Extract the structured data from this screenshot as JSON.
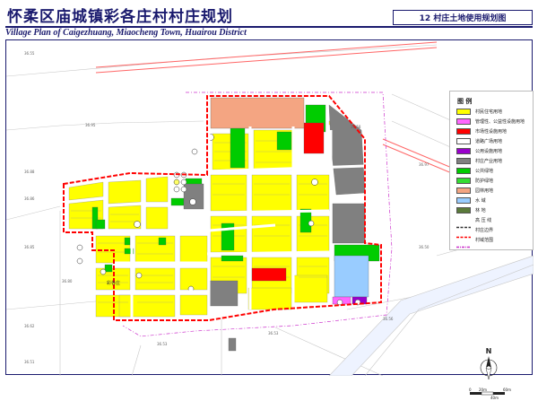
{
  "header": {
    "title_cn": "怀柔区庙城镇彩各庄村村庄规划",
    "title_en": "Village Plan of Caigezhuang, Miaocheng Town, Huairou District",
    "sheet": "12 村庄土地使用规划图"
  },
  "map": {
    "street_label": "彩各庄",
    "legend_title": "图 例",
    "legend": [
      {
        "label": "村民住宅用地",
        "color": "#ffff00",
        "kind": "fill"
      },
      {
        "label": "管理性、公益性设施用地",
        "color": "#ff66ff",
        "kind": "fill"
      },
      {
        "label": "市场性设施用地",
        "color": "#ff0000",
        "kind": "fill"
      },
      {
        "label": "道路广场用地",
        "color": "#ffffff",
        "kind": "fill"
      },
      {
        "label": "公用设施用地",
        "color": "#9900cc",
        "kind": "fill"
      },
      {
        "label": "村庄产业用地",
        "color": "#808080",
        "kind": "fill"
      },
      {
        "label": "公共绿地",
        "color": "#00cc00",
        "kind": "fill"
      },
      {
        "label": "防护绿地",
        "color": "#33dd33",
        "kind": "fill"
      },
      {
        "label": "园林用地",
        "color": "#f4a582",
        "kind": "fill"
      },
      {
        "label": "水  域",
        "color": "#99ccff",
        "kind": "fill"
      },
      {
        "label": "林  地",
        "color": "#5a7a3a",
        "kind": "fill"
      },
      {
        "label": "高 压 线",
        "color": "#333333",
        "kind": "dash"
      },
      {
        "label": "村庄边界",
        "color": "#ff0000",
        "kind": "dash"
      },
      {
        "label": "村域范围",
        "color": "#cc33cc",
        "kind": "dashdot"
      }
    ],
    "scale_labels": [
      "0",
      "20m",
      "40m",
      "60m"
    ],
    "north_label": "N",
    "colors": {
      "residential": "#ffff00",
      "industrial": "#808080",
      "green": "#00cc00",
      "market": "#ff0000",
      "garden": "#f4a582",
      "water": "#99ccff",
      "boundary": "#ff0000",
      "road": "#ffffff",
      "bg_line": "#c8c8c8"
    }
  }
}
